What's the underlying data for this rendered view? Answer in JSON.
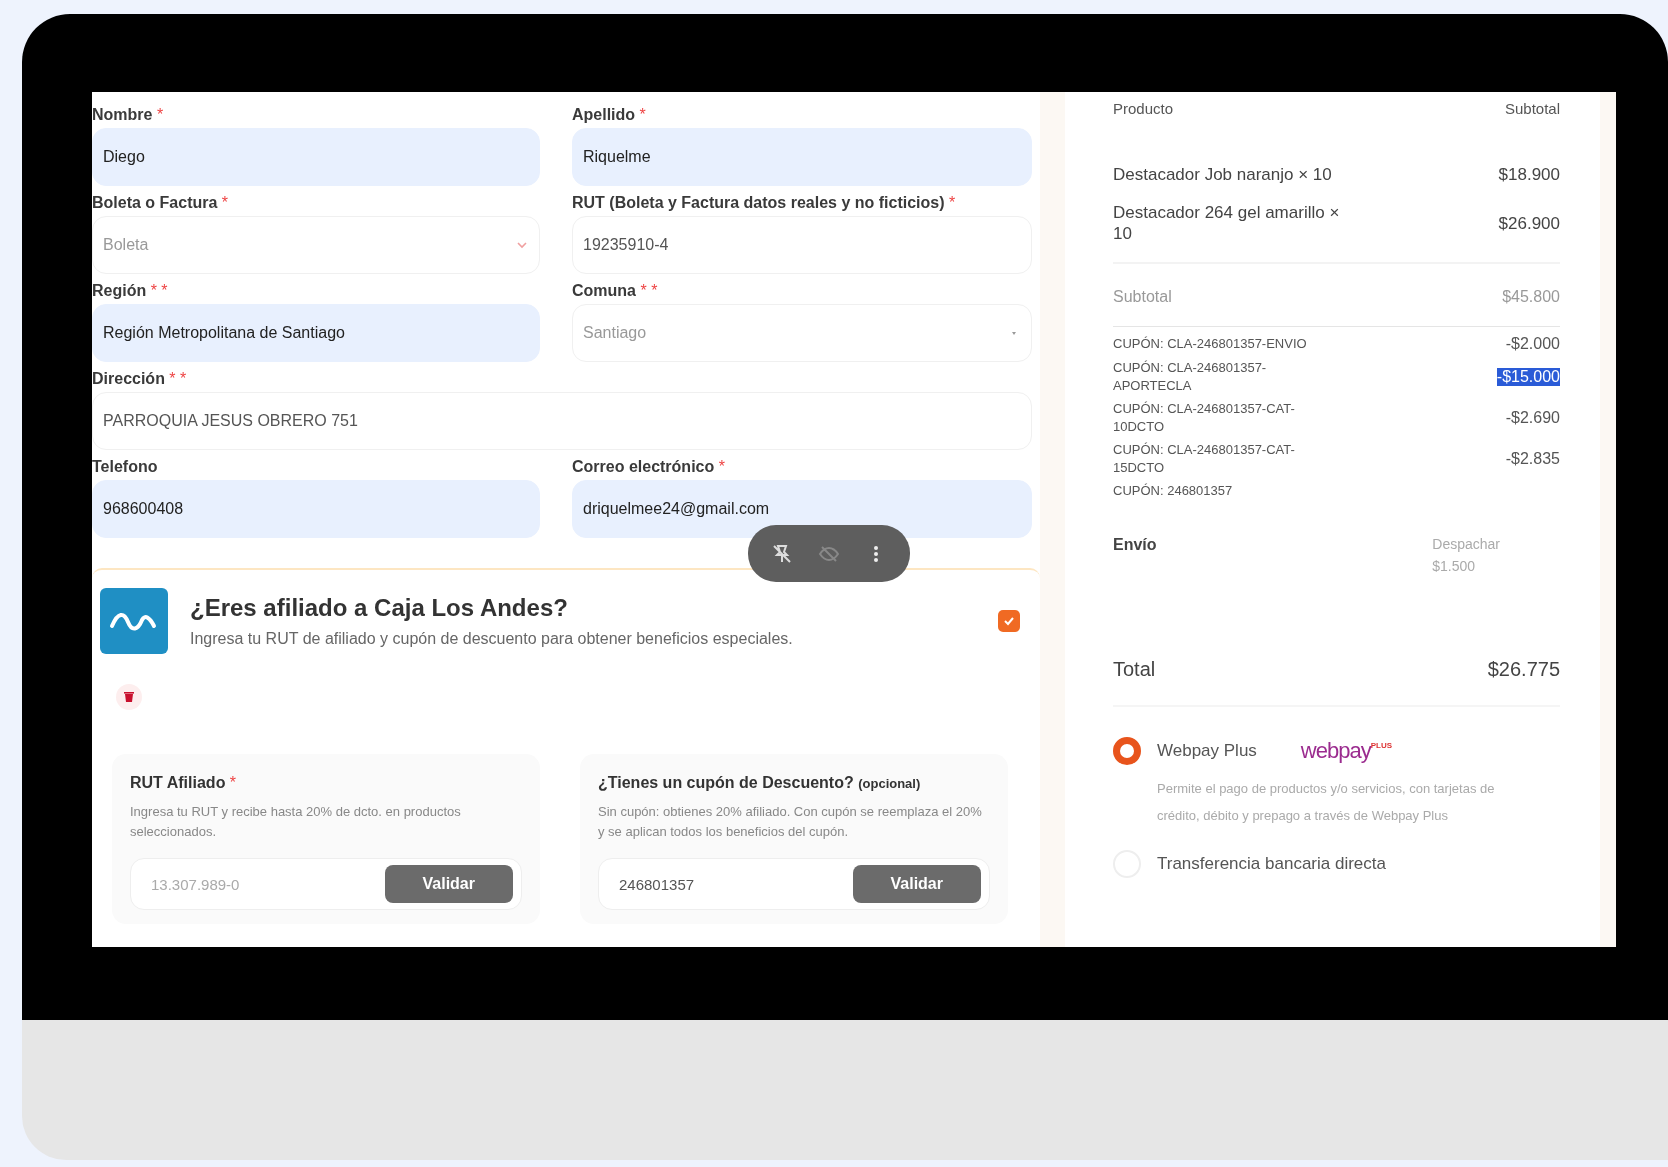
{
  "form": {
    "fields": [
      {
        "label": "Nombre",
        "required": "*",
        "kind": "text",
        "value": "Diego",
        "autofilled": true,
        "wide": false
      },
      {
        "label": "Apellido",
        "required": "*",
        "kind": "text",
        "value": "Riquelme",
        "autofilled": true,
        "wide": false
      },
      {
        "label": "Boleta o Factura",
        "required": "*",
        "kind": "select",
        "value": "Boleta",
        "autofilled": false,
        "wide": false
      },
      {
        "label": "RUT (Boleta y Factura datos reales y no ficticios)",
        "required": "*",
        "kind": "text",
        "value": "19235910-4",
        "autofilled": false,
        "wide": false
      },
      {
        "label": "Región",
        "required": "* *",
        "kind": "text",
        "value": "Región Metropolitana de Santiago",
        "autofilled": true,
        "wide": false
      },
      {
        "label": "Comuna",
        "required": "* *",
        "kind": "dropdown",
        "value": "Santiago",
        "autofilled": false,
        "wide": false
      },
      {
        "label": "Dirección",
        "required": "* *",
        "kind": "text",
        "value": "PARROQUIA JESUS OBRERO 751",
        "autofilled": false,
        "wide": true
      },
      {
        "label": "Telefono",
        "kind": "text",
        "value": "968600408",
        "autofilled": true,
        "wide": false
      },
      {
        "label": "Correo electrónico",
        "required": "*",
        "kind": "text",
        "value": "driquelmee24@gmail.com",
        "autofilled": true,
        "wide": false
      }
    ]
  },
  "affiliate": {
    "title": "¿Eres afiliado a Caja Los Andes?",
    "subtitle": "Ingresa tu RUT de afiliado y cupón de descuento para obtener beneficios especiales.",
    "checked": true,
    "panels": [
      {
        "title": "RUT Afiliado",
        "required": "*",
        "description": "Ingresa tu RUT y recibe hasta 20% de dcto. en productos seleccionados.",
        "placeholder": "13.307.989-0",
        "button": "Validar"
      },
      {
        "title": "¿Tienes un cupón de Descuento?",
        "note": "(opcional)",
        "description": "Sin cupón: obtienes 20% afiliado. Con cupón se reemplaza el 20% y se aplican todos los beneficios del cupón.",
        "value": "246801357",
        "button": "Validar"
      }
    ]
  },
  "summary": {
    "columns": [
      "Producto",
      "Subtotal"
    ],
    "items": [
      {
        "name": "Destacador Job naranjo × 10",
        "total": "$18.900"
      },
      {
        "name": "Destacador 264 gel amarillo × 10",
        "total": "$26.900"
      }
    ],
    "subtotal": {
      "label": "Subtotal",
      "value": "$45.800"
    },
    "coupons": [
      {
        "label": "CUPÓN: CLA-246801357-ENVIO",
        "amount": "-$2.000",
        "highlighted": false
      },
      {
        "label": "CUPÓN: CLA-246801357-APORTECLA",
        "amount": "-$15.000",
        "highlighted": true
      },
      {
        "label": "CUPÓN: CLA-246801357-CAT-10DCTO",
        "amount": "-$2.690",
        "highlighted": false
      },
      {
        "label": "CUPÓN: CLA-246801357-CAT-15DCTO",
        "amount": "-$2.835",
        "highlighted": false
      },
      {
        "label": "CUPÓN: 246801357",
        "highlighted": false
      }
    ],
    "shipping": {
      "label": "Envío",
      "method": "Despachar",
      "cost": "$1.500"
    },
    "total": {
      "label": "Total",
      "value": "$26.775"
    },
    "payment_methods": [
      {
        "name": "Webpay Plus",
        "selected": true,
        "logo": {
          "word": "webpay",
          "tag": "PLUS"
        },
        "description": "Permite el pago de productos y/o servicios, con tarjetas de crédito, débito y prepago a través de Webpay Plus"
      },
      {
        "name": "Transferencia bancaria directa",
        "selected": false
      }
    ]
  }
}
